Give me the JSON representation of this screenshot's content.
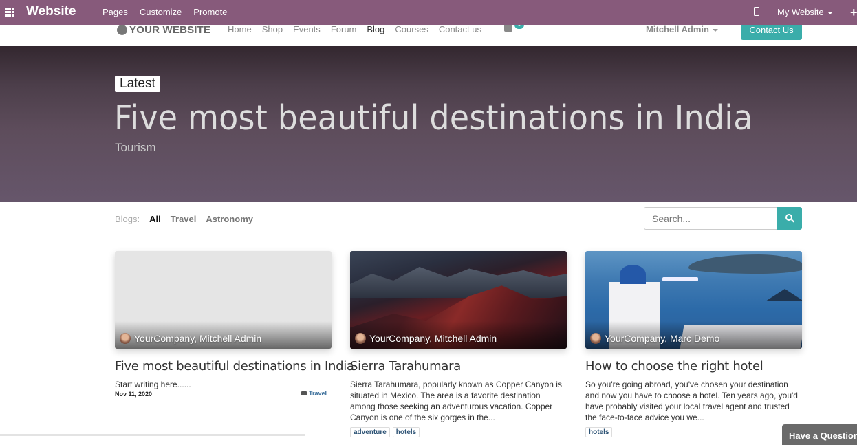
{
  "topbar": {
    "brand": "Website",
    "menu": [
      "Pages",
      "Customize",
      "Promote"
    ],
    "website_selector": "My Website",
    "icons": {
      "apps": "apps-grid-icon",
      "mobile": "mobile-preview-icon",
      "new": "plus-icon"
    },
    "color": "#875a7b"
  },
  "site_nav": {
    "logo": "YOUR WEBSITE",
    "links": [
      "Home",
      "Shop",
      "Events",
      "Forum",
      "Blog",
      "Courses",
      "Contact us"
    ],
    "active_link": "Blog",
    "cart_count": "0",
    "user": "Mitchell Admin",
    "contact_button": "Contact Us",
    "accent": "#3aadaa"
  },
  "hero": {
    "badge": "Latest",
    "title": "Five most beautiful destinations in India",
    "subtitle": "Tourism"
  },
  "filters": {
    "label": "Blogs:",
    "items": [
      "All",
      "Travel",
      "Astronomy"
    ],
    "active": "All"
  },
  "search": {
    "placeholder": "Search..."
  },
  "posts": [
    {
      "author": "YourCompany, Mitchell Admin",
      "title": "Five most beautiful destinations in India",
      "excerpt": "Start writing here......",
      "date": "Nov 11, 2020",
      "category": "Travel"
    },
    {
      "author": "YourCompany, Mitchell Admin",
      "title": "Sierra Tarahumara",
      "excerpt": "Sierra Tarahumara, popularly known as Copper Canyon is situated in Mexico. The area is a favorite destination among those seeking an adventurous vacation. Copper Canyon is one of the six gorges in the...",
      "tags": [
        "adventure",
        "hotels"
      ]
    },
    {
      "author": "YourCompany, Marc Demo",
      "title": "How to choose the right hotel",
      "excerpt": "So you're going abroad, you've chosen your destination and now you have to choose a hotel. Ten years ago, you'd have probably visited your local travel agent and trusted the face-to-face advice you we...",
      "tags": [
        "hotels"
      ]
    }
  ],
  "chat_button": "Have a Question? Chat with us."
}
